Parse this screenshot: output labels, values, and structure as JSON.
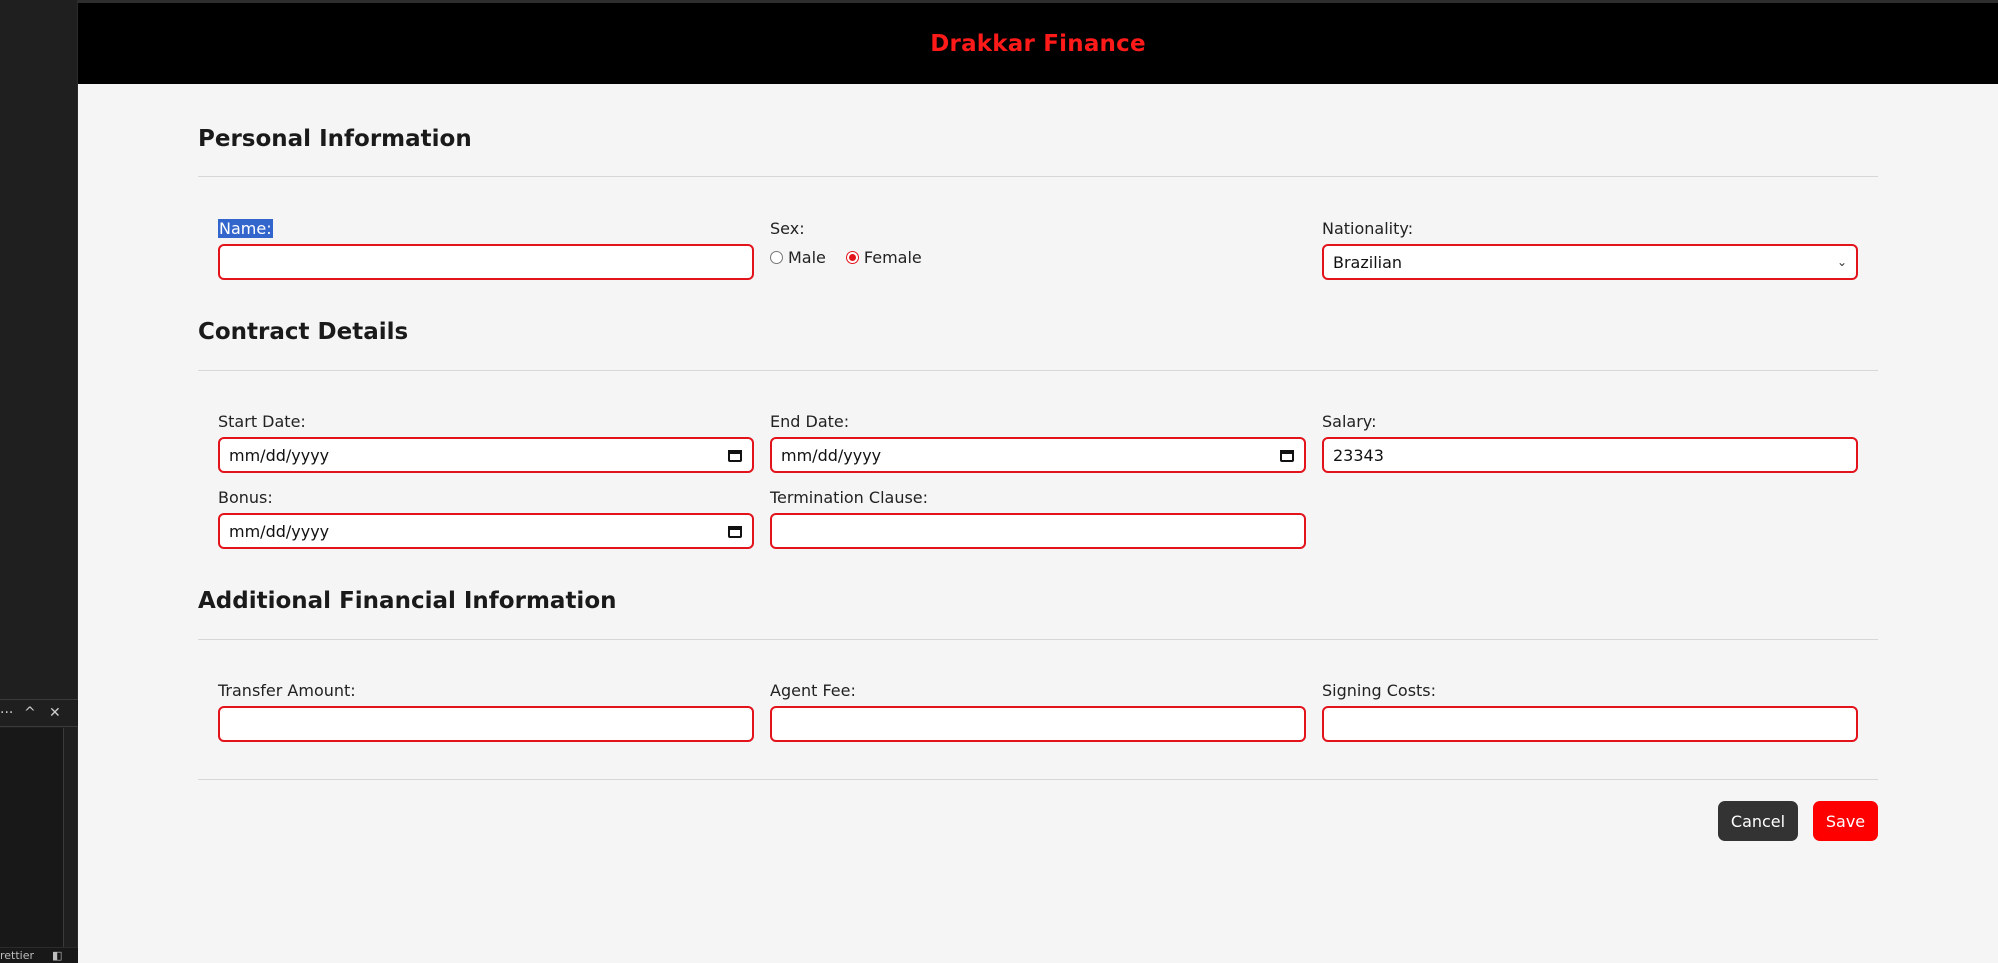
{
  "app": {
    "brand": "Drakkar Finance"
  },
  "editor": {
    "panel_more": "···",
    "panel_up": "^",
    "panel_close": "✕",
    "status_text": "rettier"
  },
  "sections": {
    "personal": "Personal Information",
    "contract": "Contract Details",
    "financial": "Additional Financial Information"
  },
  "personal": {
    "name_label": "Name:",
    "name_value": "",
    "sex_label": "Sex:",
    "sex_options": [
      "Male",
      "Female"
    ],
    "sex_selected": "Female",
    "nationality_label": "Nationality:",
    "nationality_value": "Brazilian"
  },
  "contract": {
    "start_label": "Start Date:",
    "start_placeholder": "mm/dd/yyyy",
    "end_label": "End Date:",
    "end_placeholder": "mm/dd/yyyy",
    "salary_label": "Salary:",
    "salary_value": "23343",
    "bonus_label": "Bonus:",
    "bonus_placeholder": "mm/dd/yyyy",
    "termination_label": "Termination Clause:",
    "termination_value": ""
  },
  "financial": {
    "transfer_label": "Transfer Amount:",
    "transfer_value": "",
    "agent_label": "Agent Fee:",
    "agent_value": "",
    "signing_label": "Signing Costs:",
    "signing_value": ""
  },
  "actions": {
    "cancel": "Cancel",
    "save": "Save"
  },
  "colors": {
    "accent": "#ff0000",
    "header_bg": "#000000",
    "cancel_bg": "#333333",
    "border": "#e3131b"
  }
}
